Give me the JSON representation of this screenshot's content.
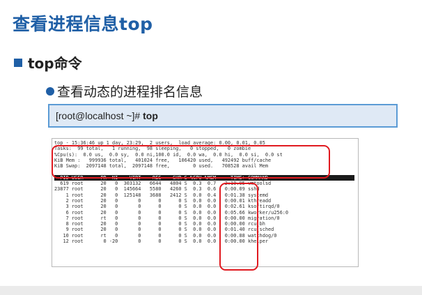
{
  "title": "查看进程信息top",
  "bullet1": "top命令",
  "bullet2": "查看动态的进程排名信息",
  "command": {
    "prompt": "[root@localhost ~]# ",
    "cmd": "top"
  },
  "terminal": {
    "summary": [
      "top - 15:36:46 up 1 day, 23:29,  2 users,  load average: 0.00, 0.01, 0.05",
      "Tasks:  99 total,   1 running,  98 sleeping,   0 stopped,   0 zombie",
      "%Cpu(s):  0.0 us,  0.0 sy,  0.0 ni,100.0 id,  0.0 wa,  0.0 hi,  0.0 si,  0.0 st",
      "KiB Mem :   999936 total,   401024 free,   106420 used,   492492 buff/cache",
      "KiB Swap:  2097148 total,  2097148 free,        0 used.   708528 avail Mem"
    ],
    "header": "  PID USER      PR  NI    VIRT    RES    SHR S %CPU %MEM     TIME+ COMMAND",
    "rows": [
      "  619 root      20   0  303132   6644   4804 S  0.3  0.7   2:10.95 vmtoolsd",
      "23877 root      20   0  145664   5580   4260 S  0.3  0.6   0:00.09 sshd",
      "    1 root      20   0  125148   3688   2412 S  0.0  0.4   0:01.38 systemd",
      "    2 root      20   0       0      0      0 S  0.0  0.0   0:00.01 kthreadd",
      "    3 root      20   0       0      0      0 S  0.0  0.0   0:02.61 ksoftirqd/0",
      "    6 root      20   0       0      0      0 S  0.0  0.0   0:05.66 kworker/u256:0",
      "    7 root      rt   0       0      0      0 S  0.0  0.0   0:00.00 migration/0",
      "    8 root      20   0       0      0      0 S  0.0  0.0   0:00.00 rcu_bh",
      "    9 root      20   0       0      0      0 S  0.0  0.0   0:01.40 rcu_sched",
      "   10 root      rt   0       0      0      0 S  0.0  0.0   0:00.88 watchdog/0",
      "   12 root       0 -20       0      0      0 S  0.0  0.0   0:00.00 khelper"
    ]
  },
  "colors": {
    "accent": "#1f5fa6",
    "highlight": "#e0191f"
  }
}
